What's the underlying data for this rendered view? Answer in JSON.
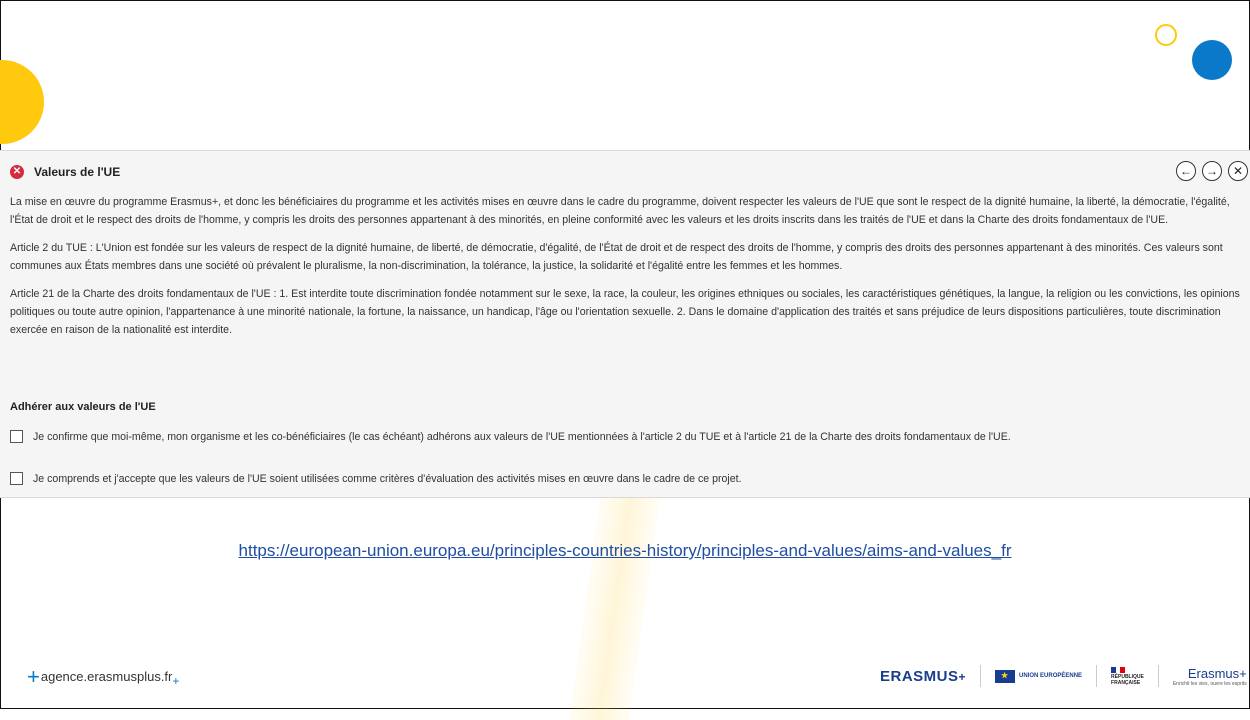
{
  "panel": {
    "title": "Valeurs de l'UE",
    "paragraphs": [
      "La mise en œuvre du programme Erasmus+, et donc les bénéficiaires du programme et les activités mises en œuvre dans le cadre du programme, doivent respecter les valeurs de l'UE que sont le respect de la dignité humaine, la liberté, la démocratie, l'égalité, l'État de droit et le respect des droits de l'homme, y compris les droits des personnes appartenant à des minorités, en pleine conformité avec les valeurs et les droits inscrits dans les traités de l'UE et dans la Charte des droits fondamentaux de l'UE.",
      "Article 2 du TUE : L'Union est fondée sur les valeurs de respect de la dignité humaine, de liberté, de démocratie, d'égalité, de l'État de droit et de respect des droits de l'homme, y compris des droits des personnes appartenant à des minorités. Ces valeurs sont communes aux États membres dans une société où prévalent le pluralisme, la non-discrimination, la tolérance, la justice, la solidarité et l'égalité entre les femmes et les hommes.",
      "Article 21 de la Charte des droits fondamentaux de l'UE : 1. Est interdite toute discrimination fondée notamment sur le sexe, la race, la couleur, les origines ethniques ou sociales, les caractéristiques génétiques, la langue, la religion ou les convictions, les opinions politiques ou toute autre opinion, l'appartenance à une minorité nationale, la fortune, la naissance, un handicap, l'âge ou l'orientation sexuelle. 2. Dans le domaine d'application des traités et sans préjudice de leurs dispositions particulières, toute discrimination exercée en raison de la nationalité est interdite."
    ],
    "adhere_title": "Adhérer aux valeurs de l'UE",
    "checkboxes": [
      "Je confirme que moi-même, mon organisme et les co-bénéficiaires (le cas échéant) adhérons aux valeurs de l'UE mentionnées à l'article 2 du TUE et à l'article 21 de la Charte des droits fondamentaux de l'UE.",
      "Je comprends et j'accepte que les valeurs de l'UE soient utilisées comme critères d'évaluation des activités mises en œuvre dans le cadre de ce projet."
    ]
  },
  "link": "https://european-union.europa.eu/principles-countries-history/principles-and-values/aims-and-values_fr",
  "footer": {
    "site": "agence.erasmusplus.fr",
    "logo_erasmus": "ERASMUS",
    "logo_eu": "UNION EUROPÉENNE",
    "logo_rf_line1": "RÉPUBLIQUE",
    "logo_rf_line2": "FRANÇAISE",
    "logo_erasmus_plus": "Erasmus+",
    "logo_erasmus_plus_tag": "Enrichit les vies, ouvre les esprits"
  },
  "colors": {
    "accent_blue": "#0a79c9",
    "accent_yellow": "#ffc90e",
    "error_red": "#d62b3f"
  }
}
